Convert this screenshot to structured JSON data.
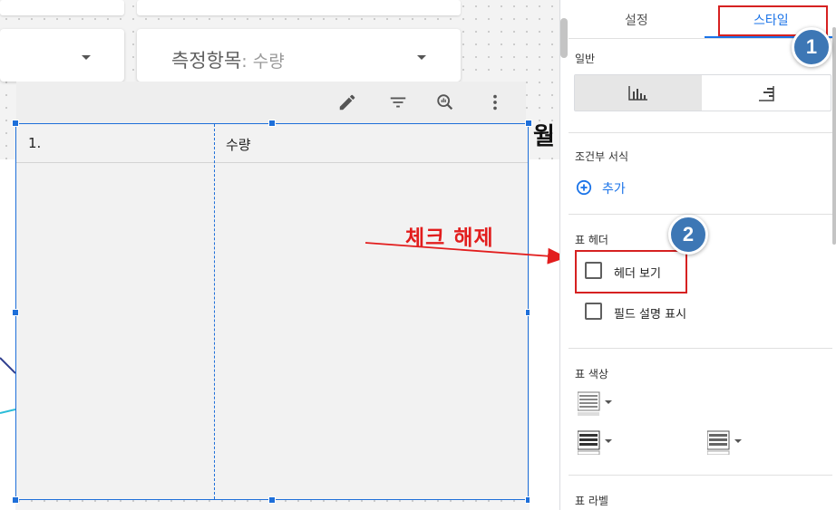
{
  "canvas": {
    "metric_dropdown": {
      "label": "측정항목",
      "value": ": 수량"
    },
    "toolbar": {
      "icons": [
        "pencil-icon",
        "filter-icon",
        "explore-icon",
        "more-vert-icon"
      ]
    },
    "table": {
      "header_cells": [
        "1.",
        "수량"
      ]
    },
    "partial_right_text": "월",
    "annotation": {
      "text": "체크 해제"
    }
  },
  "panel": {
    "tabs": {
      "setup": "설정",
      "style": "스타일"
    },
    "sections": {
      "general": "일반",
      "conditional": "조건부 서식",
      "add_label": "추가",
      "table_header": "표 헤더",
      "show_header": "헤더 보기",
      "show_field_desc": "필드 설명 표시",
      "table_colors": "표 색상",
      "table_labels": "표 라벨"
    },
    "badges": {
      "one": "1",
      "two": "2"
    }
  },
  "colors": {
    "accent": "#1a73e8",
    "annotation_red": "#e21d1d",
    "badge_blue": "#3d77b5"
  }
}
